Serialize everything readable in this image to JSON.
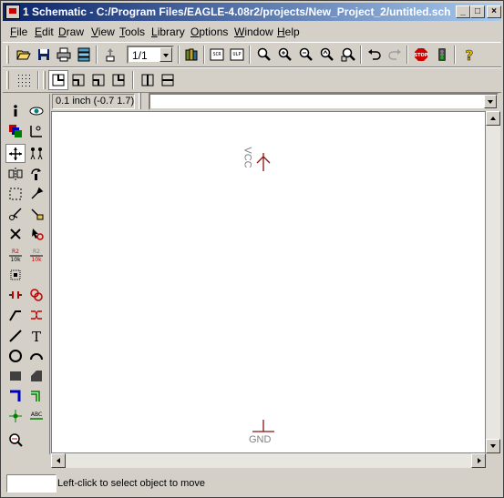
{
  "window": {
    "title": "1 Schematic - C:/Program Files/EAGLE-4.08r2/projects/New_Project_2/untitled.sch",
    "minimize": "_",
    "maximize": "□",
    "close": "×"
  },
  "menu": [
    {
      "label": "File",
      "mnemonic": "F",
      "rest": "ile"
    },
    {
      "label": "Edit",
      "mnemonic": "E",
      "rest": "dit"
    },
    {
      "label": "Draw",
      "mnemonic": "D",
      "rest": "raw"
    },
    {
      "label": "View",
      "mnemonic": "V",
      "rest": "iew"
    },
    {
      "label": "Tools",
      "mnemonic": "T",
      "rest": "ools"
    },
    {
      "label": "Library",
      "mnemonic": "L",
      "rest": "ibrary"
    },
    {
      "label": "Options",
      "mnemonic": "O",
      "rest": "ptions"
    },
    {
      "label": "Window",
      "mnemonic": "W",
      "rest": "indow"
    },
    {
      "label": "Help",
      "mnemonic": "H",
      "rest": "elp"
    }
  ],
  "toolbar": {
    "sheet_select": "1/1",
    "icons": [
      "open-icon",
      "save-icon",
      "print-icon",
      "cam-icon",
      "sheet-icon",
      "library-icon",
      "script-icon",
      "ulp-icon",
      "zoom-fit-icon",
      "zoom-in-icon",
      "zoom-out-icon",
      "zoom-redraw-icon",
      "zoom-select-icon",
      "undo-icon",
      "redo-icon",
      "stop-icon",
      "go-icon",
      "help-icon"
    ],
    "stop_label": "STOP"
  },
  "command_bar": {
    "coordinates": "0.1 inch (-0.7 1.7)",
    "command_value": ""
  },
  "canvas": {
    "vcc_label": "VCC",
    "gnd_label": "GND"
  },
  "statusbar": {
    "message": "Left-click to select object to move"
  },
  "left_tools": {
    "r2_label": "R2",
    "r2_value": "10k",
    "text_tool": "T",
    "abc_label": "ABC"
  }
}
